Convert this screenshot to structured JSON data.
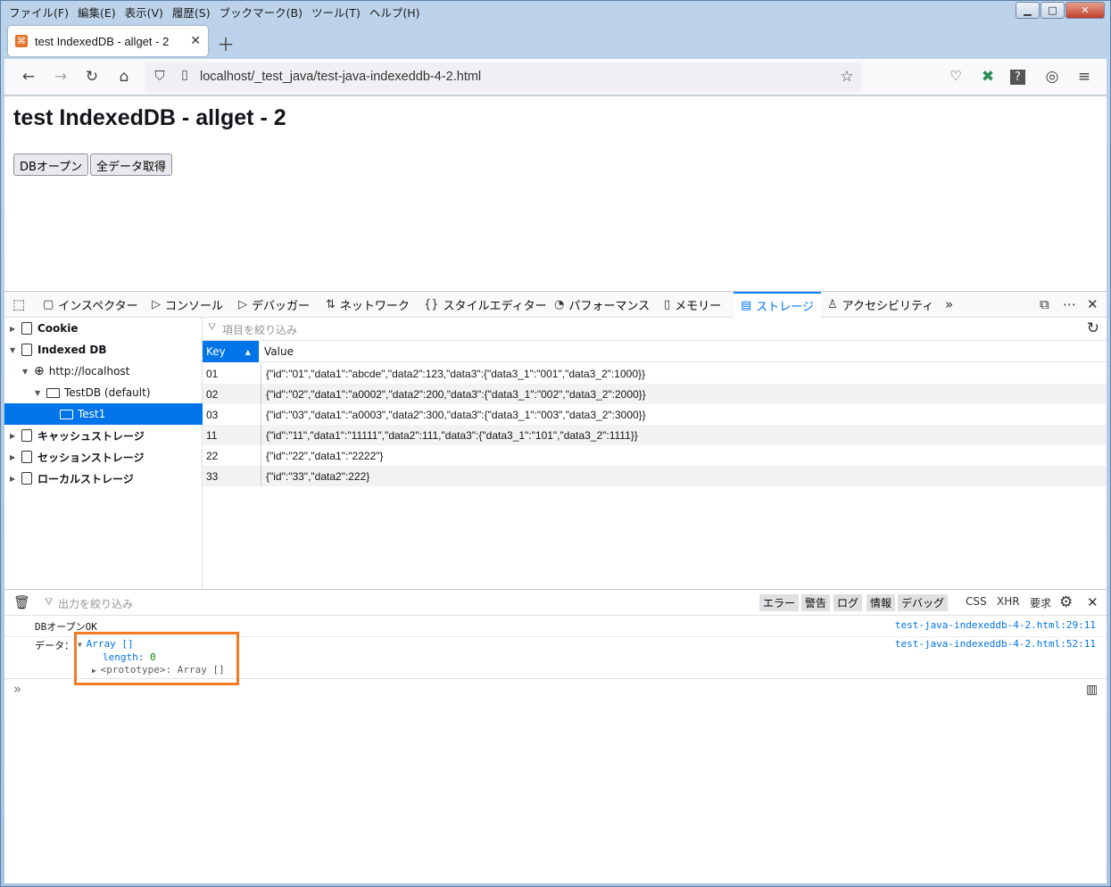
{
  "menu": [
    "ファイル(F)",
    "編集(E)",
    "表示(V)",
    "履歴(S)",
    "ブックマーク(B)",
    "ツール(T)",
    "ヘルプ(H)"
  ],
  "tab": {
    "title": "test IndexedDB - allget - 2"
  },
  "url": "localhost/_test_java/test-java-indexeddb-4-2.html",
  "page": {
    "heading": "test IndexedDB - allget - 2",
    "btn_open": "DBオープン",
    "btn_get": "全データ取得"
  },
  "devtools": {
    "tabs": [
      "インスペクター",
      "コンソール",
      "デバッガー",
      "ネットワーク",
      "スタイルエディター",
      "パフォーマンス",
      "メモリー",
      "ストレージ",
      "アクセシビリティ"
    ],
    "tree": {
      "cookie": "Cookie",
      "indexeddb": "Indexed DB",
      "host": "http://localhost",
      "db": "TestDB (default)",
      "store": "Test1",
      "cache": "キャッシュストレージ",
      "session": "セッションストレージ",
      "local": "ローカルストレージ"
    },
    "filter_placeholder": "項目を絞り込み",
    "table": {
      "col_key": "Key",
      "col_value": "Value",
      "rows": [
        {
          "key": "01",
          "value": "{\"id\":\"01\",\"data1\":\"abcde\",\"data2\":123,\"data3\":{\"data3_1\":\"001\",\"data3_2\":1000}}"
        },
        {
          "key": "02",
          "value": "{\"id\":\"02\",\"data1\":\"a0002\",\"data2\":200,\"data3\":{\"data3_1\":\"002\",\"data3_2\":2000}}"
        },
        {
          "key": "03",
          "value": "{\"id\":\"03\",\"data1\":\"a0003\",\"data2\":300,\"data3\":{\"data3_1\":\"003\",\"data3_2\":3000}}"
        },
        {
          "key": "11",
          "value": "{\"id\":\"11\",\"data1\":\"11111\",\"data2\":111,\"data3\":{\"data3_1\":\"101\",\"data3_2\":1111}}"
        },
        {
          "key": "22",
          "value": "{\"id\":\"22\",\"data1\":\"2222\"}"
        },
        {
          "key": "33",
          "value": "{\"id\":\"33\",\"data2\":222}"
        }
      ]
    },
    "console": {
      "filter_placeholder": "出力を絞り込み",
      "chips": [
        "エラー",
        "警告",
        "ログ",
        "情報",
        "デバッグ"
      ],
      "plain_chips": [
        "CSS",
        "XHR",
        "要求"
      ],
      "line1": {
        "msg": "DBオープンOK",
        "src": "test-java-indexeddb-4-2.html:29:11"
      },
      "line2": {
        "label": "データ：",
        "array": "Array []",
        "length_label": "length:",
        "length_value": "0",
        "proto": "<prototype>: Array []",
        "src": "test-java-indexeddb-4-2.html:52:11"
      }
    }
  },
  "colors": {
    "accent": "#0074e8",
    "highlight": "#f47b20"
  }
}
